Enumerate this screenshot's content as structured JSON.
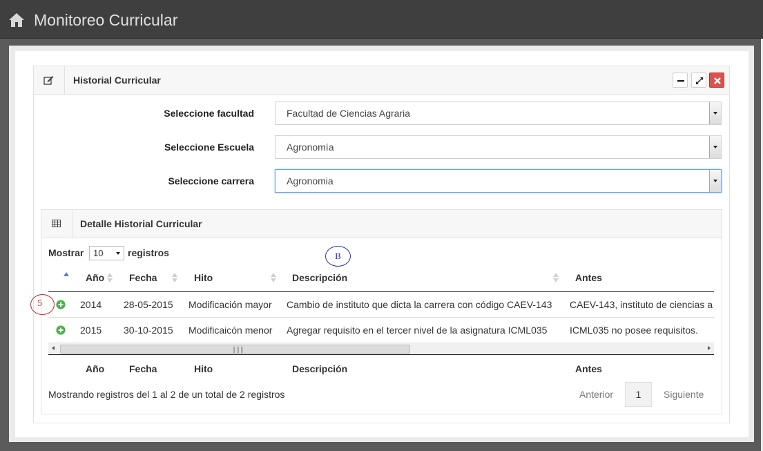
{
  "app": {
    "title": "Monitoreo Curricular",
    "home_icon": "home-icon"
  },
  "historial": {
    "title": "Historial Curricular",
    "header_icon": "edit-icon",
    "buttons": [
      {
        "name": "minimize-button",
        "icon": "minus-icon"
      },
      {
        "name": "expand-button",
        "icon": "expand-icon"
      },
      {
        "name": "close-button",
        "icon": "close-icon",
        "color": "#d9534f"
      }
    ],
    "fields": {
      "facultad": {
        "label": "Seleccione facultad",
        "value": "Facultad de Ciencias Agraria"
      },
      "escuela": {
        "label": "Seleccione Escuela",
        "value": "Agronomía"
      },
      "carrera": {
        "label": "Seleccione carrera",
        "value": "Agronomia"
      }
    }
  },
  "detalle": {
    "title": "Detalle Historial Curricular",
    "header_icon": "table-icon",
    "length": {
      "prefix": "Mostrar",
      "value": "10",
      "suffix": "registros"
    },
    "columns": [
      "Año",
      "Fecha",
      "Hito",
      "Descripción",
      "Antes"
    ],
    "rows": [
      {
        "anio": "2014",
        "fecha": "28-05-2015",
        "hito": "Modificación mayor",
        "descripcion": "Cambio de instituto que dicta la carrera con código CAEV-143",
        "antes": "CAEV-143, instituto de ciencias a"
      },
      {
        "anio": "2015",
        "fecha": "30-10-2015",
        "hito": "Modificaicón menor",
        "descripcion": "Agregar requisito en el tercer nivel de la asignatura ICML035",
        "antes": "ICML035 no posee requisitos."
      }
    ],
    "info": "Mostrando registros del 1 al 2 de un total de 2 registros",
    "pagination": {
      "previous": "Anterior",
      "current": "1",
      "next": "Siguiente"
    },
    "expand_icon": "plus-circle-icon",
    "accent_green": "#4cae4c"
  },
  "annotations": {
    "circle_5": "5",
    "circle_b": "B"
  }
}
